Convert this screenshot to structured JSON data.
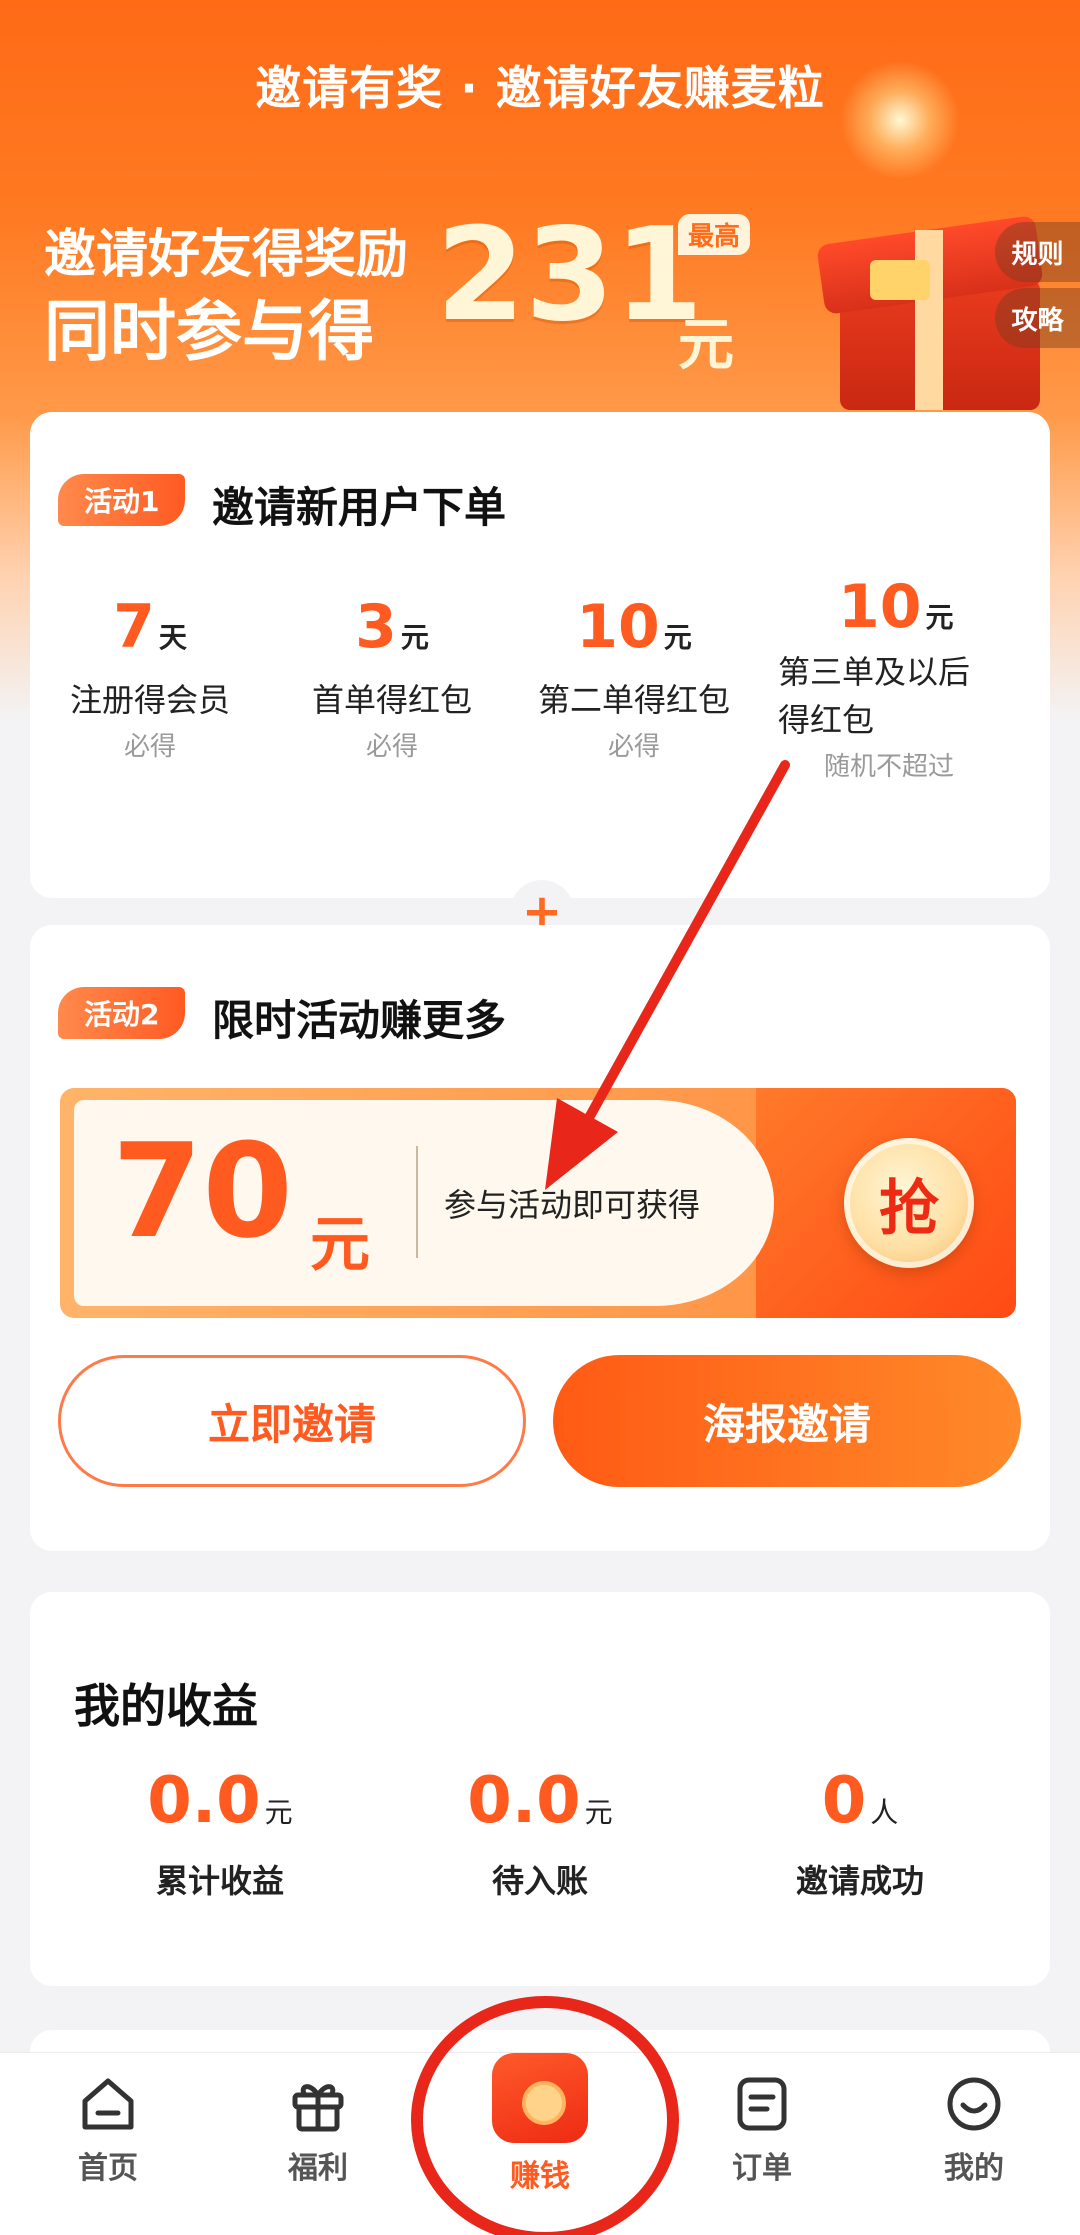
{
  "hero": {
    "title": "邀请有奖 · 邀请好友赚麦粒",
    "line1": "邀请好友得奖励",
    "line2": "同时参与得",
    "amount": "231",
    "unit": "元",
    "badge": "最高",
    "rules_tab": "规则",
    "guide_tab": "攻略"
  },
  "activity1": {
    "tag": "活动1",
    "title": "邀请新用户下单",
    "rewards": [
      {
        "value": "7",
        "unit": "天",
        "label": "注册得会员",
        "sub": "必得"
      },
      {
        "value": "3",
        "unit": "元",
        "label": "首单得红包",
        "sub": "必得"
      },
      {
        "value": "10",
        "unit": "元",
        "label": "第二单得红包",
        "sub": "必得"
      },
      {
        "value": "10",
        "unit": "元",
        "label_line1": "第三单及以后",
        "label_line2": "得红包",
        "sub": "随机不超过"
      }
    ]
  },
  "plus_symbol": "+",
  "activity2": {
    "tag": "活动2",
    "title": "限时活动赚更多",
    "coupon_amount": "70",
    "coupon_unit": "元",
    "coupon_desc": "参与活动即可获得",
    "grab_label": "抢",
    "invite_now": "立即邀请",
    "poster_invite": "海报邀请"
  },
  "earnings": {
    "title": "我的收益",
    "stats": [
      {
        "value": "0.0",
        "unit": "元",
        "label": "累计收益"
      },
      {
        "value": "0.0",
        "unit": "元",
        "label": "待入账"
      },
      {
        "value": "0",
        "unit": "人",
        "label": "邀请成功"
      }
    ]
  },
  "nav": {
    "items": [
      {
        "label": "首页",
        "icon": "home-icon"
      },
      {
        "label": "福利",
        "icon": "gift-icon"
      },
      {
        "label": "赚钱",
        "icon": "red-envelope-icon",
        "active": true
      },
      {
        "label": "订单",
        "icon": "order-icon"
      },
      {
        "label": "我的",
        "icon": "smile-icon"
      }
    ]
  },
  "colors": {
    "brand_orange": "#ff5a1f",
    "annotation_red": "#e8261a"
  }
}
